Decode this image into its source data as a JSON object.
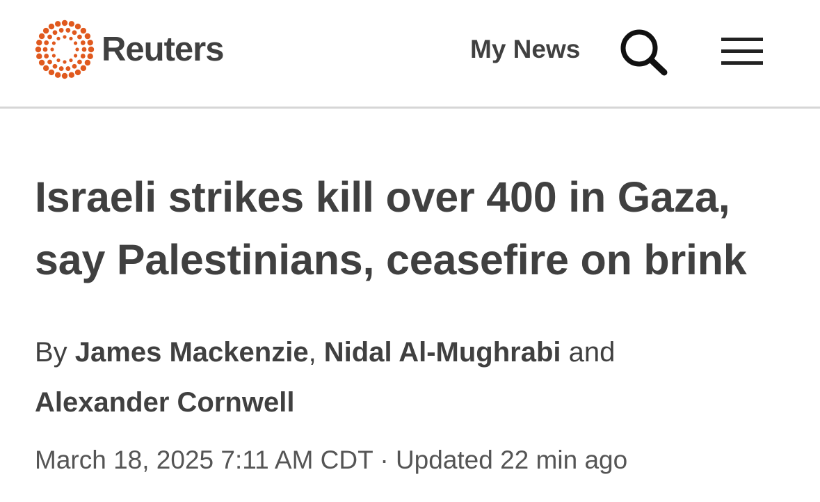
{
  "header": {
    "brand": "Reuters",
    "logo_color": "#e0591e",
    "my_news_label": "My News",
    "search_icon": "search-icon",
    "menu_icon": "hamburger-menu-icon"
  },
  "article": {
    "headline_line1": "Israeli strikes kill over 400 in Gaza,",
    "headline_line2": "say Palestinians, ceasefire on brink",
    "byline": {
      "prefix": "By ",
      "author1": "James Mackenzie",
      "separator": ", ",
      "author2": "Nidal Al-Mughrabi",
      "conjunction": " and",
      "author3": "Alexander Cornwell"
    },
    "date": "March 18, 2025 7:11 AM CDT",
    "date_separator": " · ",
    "updated": "Updated 22 min ago"
  },
  "colors": {
    "text": "#404040",
    "divider": "#d6d6d6",
    "brand_orange": "#e0591e"
  }
}
